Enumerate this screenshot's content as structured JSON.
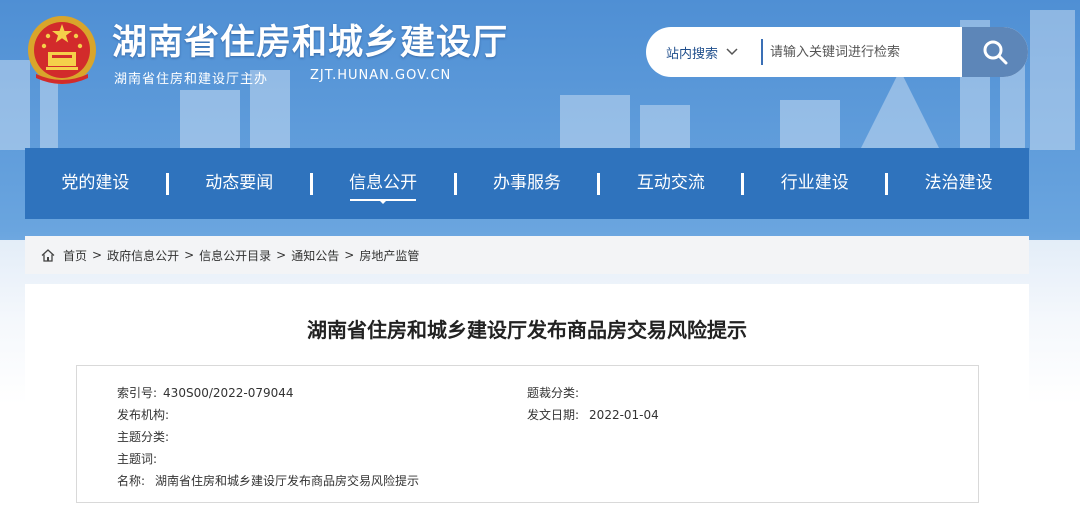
{
  "site": {
    "title": "湖南省住房和城乡建设厅",
    "subtitle": "湖南省住房和建设厅主办",
    "domain": "ZJT.HUNAN.GOV.CN"
  },
  "search": {
    "scope": "站内搜索",
    "placeholder": "请输入关键词进行检索"
  },
  "nav": {
    "items": [
      {
        "label": "党的建设"
      },
      {
        "label": "动态要闻"
      },
      {
        "label": "信息公开"
      },
      {
        "label": "办事服务"
      },
      {
        "label": "互动交流"
      },
      {
        "label": "行业建设"
      },
      {
        "label": "法治建设"
      }
    ],
    "active_index": 2
  },
  "breadcrumb": {
    "items": [
      "首页",
      "政府信息公开",
      "信息公开目录",
      "通知公告",
      "房地产监管"
    ],
    "separator": ">"
  },
  "article": {
    "title": "湖南省住房和城乡建设厅发布商品房交易风险提示"
  },
  "meta": {
    "index_label": "索引号:",
    "index_value": "430S00/2022-079044",
    "genre_label": "题裁分类:",
    "genre_value": "",
    "publisher_label": "发布机构:",
    "publisher_value": "",
    "date_label": "发文日期:",
    "date_value": "2022-01-04",
    "topic_label": "主题分类:",
    "topic_value": "",
    "keywords_label": "主题词:",
    "keywords_value": "",
    "name_label": "名称:",
    "name_value": "湖南省住房和城乡建设厅发布商品房交易风险提示"
  },
  "colors": {
    "nav_bg": "#2f73bd",
    "search_btn": "#5d86b8",
    "header_bg": "#4f8fd4"
  }
}
